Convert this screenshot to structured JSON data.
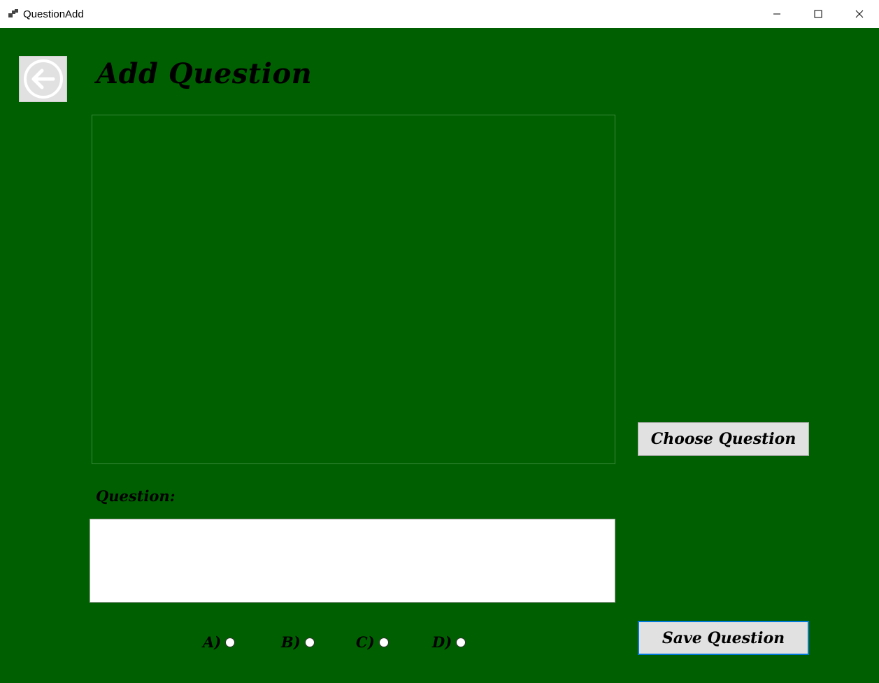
{
  "window": {
    "title": "QuestionAdd",
    "controls": {
      "minimize": "minimize",
      "maximize": "maximize",
      "close": "close"
    }
  },
  "header": {
    "title": "Add Question",
    "back_icon": "back-arrow-icon"
  },
  "buttons": {
    "choose": "Choose Question",
    "save": "Save Question"
  },
  "question": {
    "label": "Question:",
    "value": ""
  },
  "options": [
    {
      "label": "A)",
      "checked": false
    },
    {
      "label": "B)",
      "checked": false
    },
    {
      "label": "C)",
      "checked": false
    },
    {
      "label": "D)",
      "checked": false
    }
  ],
  "colors": {
    "background": "#005f00",
    "button_face": "#e1e1e1",
    "focus_border": "#0078d7"
  }
}
